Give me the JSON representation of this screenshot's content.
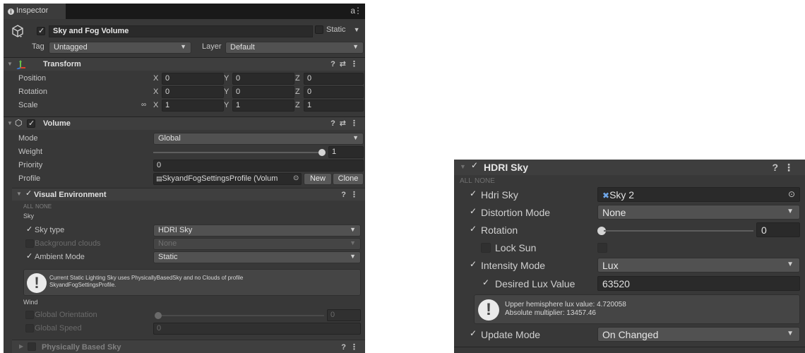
{
  "inspector": {
    "tab_label": "Inspector",
    "lock_icon": "lock-icon",
    "object": {
      "active": true,
      "name": "Sky and Fog Volume",
      "static_label": "Static",
      "tag_label": "Tag",
      "tag_value": "Untagged",
      "layer_label": "Layer",
      "layer_value": "Default"
    },
    "transform": {
      "title": "Transform",
      "rows": [
        {
          "label": "Position",
          "x": "0",
          "y": "0",
          "z": "0"
        },
        {
          "label": "Rotation",
          "x": "0",
          "y": "0",
          "z": "0"
        },
        {
          "label": "Scale",
          "x": "1",
          "y": "1",
          "z": "1"
        }
      ],
      "axis_x": "X",
      "axis_y": "Y",
      "axis_z": "Z"
    },
    "volume": {
      "title": "Volume",
      "mode_label": "Mode",
      "mode_value": "Global",
      "weight_label": "Weight",
      "weight_value": "1",
      "priority_label": "Priority",
      "priority_value": "0",
      "profile_label": "Profile",
      "profile_value": "SkyandFogSettingsProfile (Volum",
      "new_label": "New",
      "clone_label": "Clone"
    },
    "visual_environment": {
      "title": "Visual Environment",
      "all_label": "ALL",
      "none_label": "NONE",
      "sky_section": "Sky",
      "sky_type_label": "Sky type",
      "sky_type_value": "HDRI Sky",
      "bg_clouds_label": "Background clouds",
      "bg_clouds_value": "None",
      "ambient_label": "Ambient Mode",
      "ambient_value": "Static",
      "warning_line1": "Current Static Lighting Sky uses PhysicallyBasedSky and no Clouds of profile",
      "warning_line2": "SkyandFogSettingsProfile.",
      "wind_section": "Wind",
      "global_orientation_label": "Global Orientation",
      "global_orientation_value": "0",
      "global_speed_label": "Global Speed",
      "global_speed_value": "0"
    },
    "physically_based_sky": {
      "title": "Physically Based Sky"
    }
  },
  "hdri_panel": {
    "title": "HDRI Sky",
    "all_label": "ALL",
    "none_label": "NONE",
    "hdri_sky_label": "Hdri Sky",
    "hdri_sky_value": "Sky 2",
    "distortion_label": "Distortion Mode",
    "distortion_value": "None",
    "rotation_label": "Rotation",
    "rotation_value": "0",
    "lock_sun_label": "Lock Sun",
    "intensity_label": "Intensity Mode",
    "intensity_value": "Lux",
    "lux_label": "Desired Lux Value",
    "lux_value": "63520",
    "info_line1": "Upper hemisphere lux value: 4.720058",
    "info_line2": "Absolute multiplier: 13457.46",
    "update_label": "Update Mode",
    "update_value": "On Changed"
  }
}
